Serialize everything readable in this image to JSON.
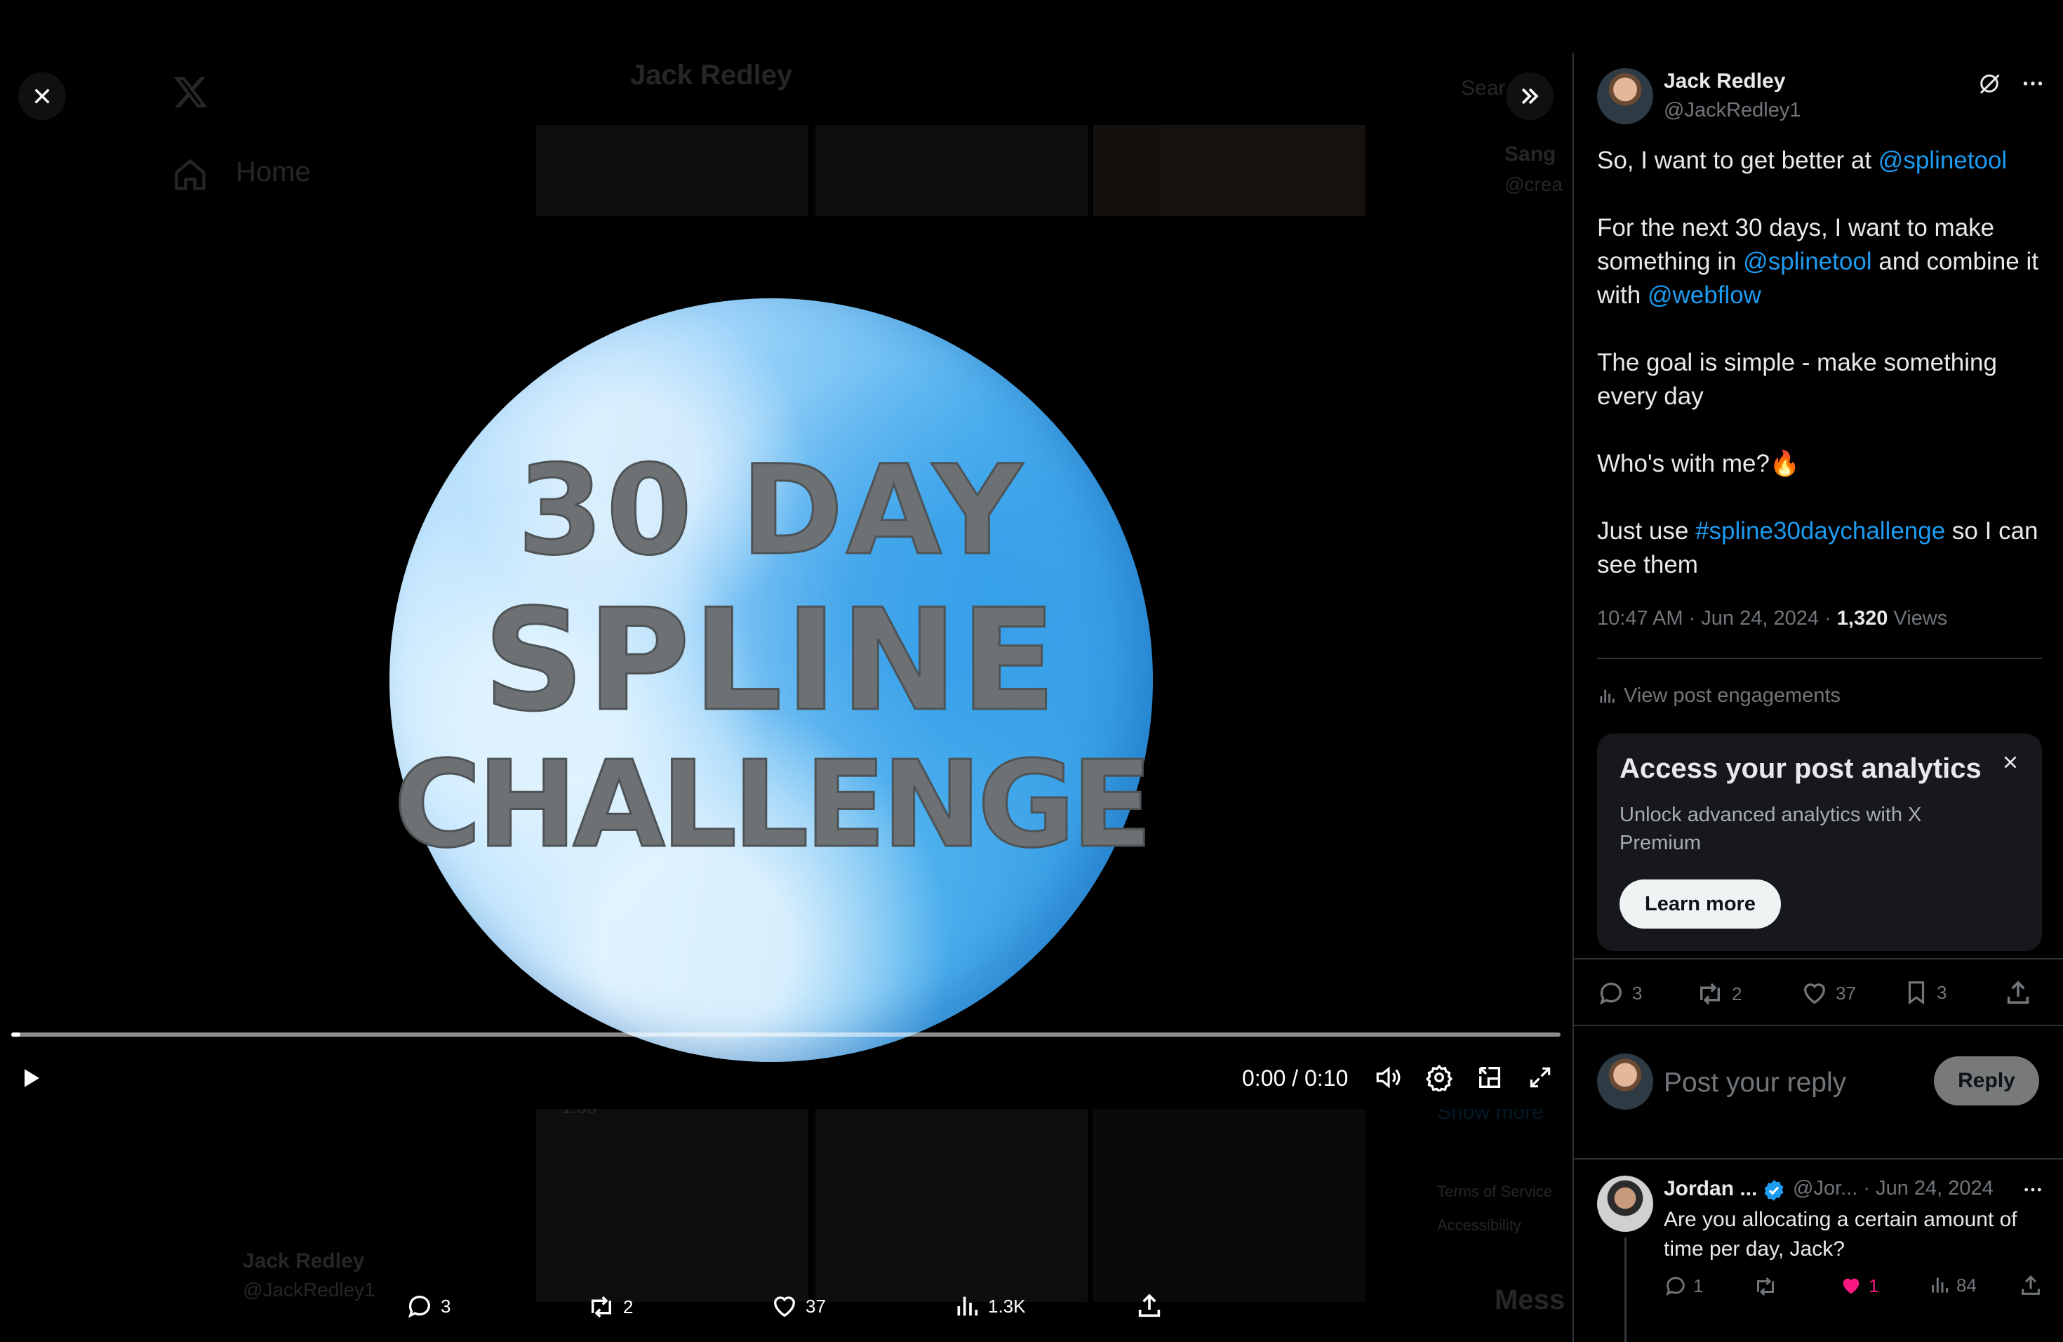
{
  "background_page": {
    "profile_name": "Jack Redley",
    "nav_home": "Home",
    "search_placeholder": "Sear",
    "suggest_name": "Sang",
    "suggest_handle": "@crea",
    "footer_name": "Jack Redley",
    "footer_handle": "@JackRedley1",
    "show_more": "Show more",
    "terms": "Terms of Service",
    "accessibility": "Accessibility",
    "tile_duration": "1:00",
    "messages": "Mess"
  },
  "player": {
    "video_text": [
      "30 DAY",
      "SPLINE",
      "CHALLENGE"
    ],
    "time": "0:00 / 0:10",
    "progress": 0.006
  },
  "bottom_actions": {
    "replies": "3",
    "reposts": "2",
    "likes": "37",
    "views": "1.3K"
  },
  "post": {
    "author_name": "Jack Redley",
    "author_handle": "@JackRedley1",
    "text_parts": [
      {
        "t": "So, I want to get better at ",
        "link": false
      },
      {
        "t": "@splinetool",
        "link": true
      },
      {
        "t": "\n\nFor the next 30 days, I want to make something in ",
        "link": false
      },
      {
        "t": "@splinetool",
        "link": true
      },
      {
        "t": " and combine it with ",
        "link": false
      },
      {
        "t": "@webflow",
        "link": true
      },
      {
        "t": "\n\nThe goal is simple - make something every day\n\nWho's with me?🔥\n\nJust use ",
        "link": false
      },
      {
        "t": "#spline30daychallenge",
        "link": true
      },
      {
        "t": " so I can see them",
        "link": false
      }
    ],
    "time": "10:47 AM · Jun 24, 2024 · ",
    "views_count": "1,320",
    "views_label": " Views",
    "engagements_label": "View post engagements",
    "replies": "3",
    "reposts": "2",
    "likes": "37",
    "bookmarks": "3"
  },
  "promo": {
    "title": "Access your post analytics",
    "description": "Unlock advanced analytics with X Premium",
    "button": "Learn more"
  },
  "reply_box": {
    "placeholder": "Post your reply",
    "button": "Reply"
  },
  "comment": {
    "name": "Jordan ...",
    "meta": "@Jor... · Jun 24, 2024",
    "text": "Are you allocating a certain amount of time per day, Jack?",
    "replies": "1",
    "likes": "1",
    "views": "84"
  },
  "colors": {
    "accent": "#1d9bf0",
    "like": "#f91880",
    "verified": "#1d9bf0"
  }
}
